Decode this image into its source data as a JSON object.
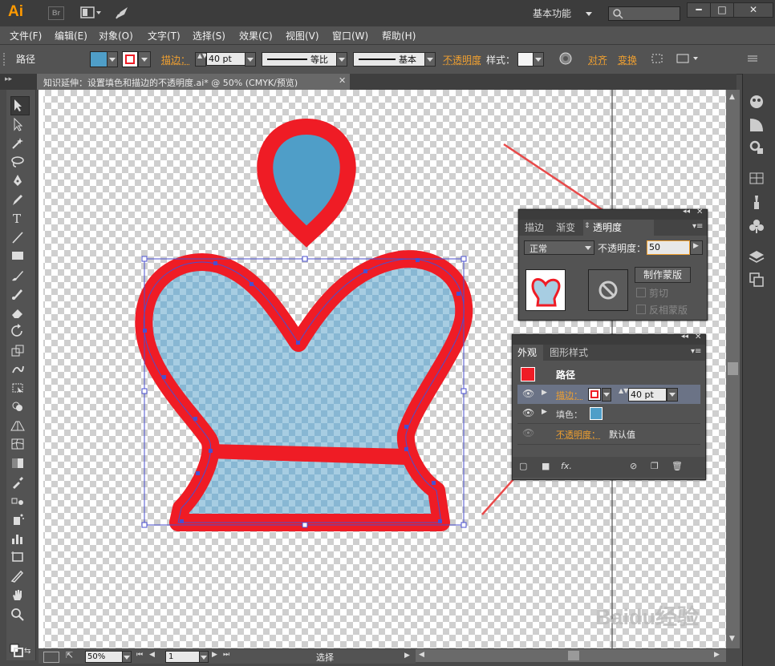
{
  "app": {
    "logo": "Ai",
    "bridge": "Br",
    "workspace": "基本功能",
    "search_placeholder": ""
  },
  "menu": [
    "文件(F)",
    "编辑(E)",
    "对象(O)",
    "文字(T)",
    "选择(S)",
    "效果(C)",
    "视图(V)",
    "窗口(W)",
    "帮助(H)"
  ],
  "control": {
    "object_label": "路径",
    "stroke_label": "描边：",
    "stroke_value": "40 pt",
    "profile_label": "等比",
    "brush_label": "基本",
    "opacity_label": "不透明度",
    "style_label": "样式：",
    "align_label": "对齐",
    "transform_label": "变换"
  },
  "document": {
    "tab_title": "知识延伸：设置填色和描边的不透明度.ai* @ 50% (CMYK/预览)"
  },
  "transparency_panel": {
    "tabs": [
      "描边",
      "渐变",
      "透明度"
    ],
    "active_tab": "透明度",
    "blend_mode": "正常",
    "opacity_label": "不透明度：",
    "opacity_value": "50",
    "make_mask_button": "制作蒙版",
    "clip_label": "剪切",
    "invert_label": "反相蒙版"
  },
  "appearance_panel": {
    "tabs": [
      "外观",
      "图形样式"
    ],
    "active_tab": "外观",
    "title": "路径",
    "stroke_label": "描边：",
    "stroke_value": "40 pt",
    "fill_label": "填色：",
    "opacity_label": "不透明度：",
    "opacity_value": "默认值"
  },
  "status": {
    "zoom": "50%",
    "page": "1",
    "mode": "选择"
  },
  "watermark": "Baidu经验",
  "colors": {
    "fill": "#4f9ec8",
    "stroke": "#ef1c25",
    "accent": "#f0a030",
    "selection": "#4a4fcf"
  },
  "icons": {
    "tools": [
      "selection-tool",
      "direct-selection-tool",
      "magic-wand-tool",
      "lasso-tool",
      "pen-tool",
      "pencil-brush-tool",
      "type-tool",
      "line-tool",
      "rectangle-tool",
      "paintbrush-tool",
      "blob-brush-tool",
      "eraser-tool",
      "rotate-tool",
      "scale-tool",
      "warp-tool",
      "free-transform-tool",
      "shape-builder-tool",
      "perspective-grid-tool",
      "mesh-tool",
      "gradient-tool",
      "eyedropper-tool",
      "blend-tool",
      "symbol-sprayer-tool",
      "column-graph-tool",
      "artboard-tool",
      "slice-tool",
      "hand-tool",
      "zoom-tool"
    ],
    "dock": [
      "color-icon",
      "gradient-icon",
      "swatch-icon",
      "table-icon",
      "brush-icon",
      "club-icon",
      "layers-icon",
      "artboards-icon"
    ]
  }
}
